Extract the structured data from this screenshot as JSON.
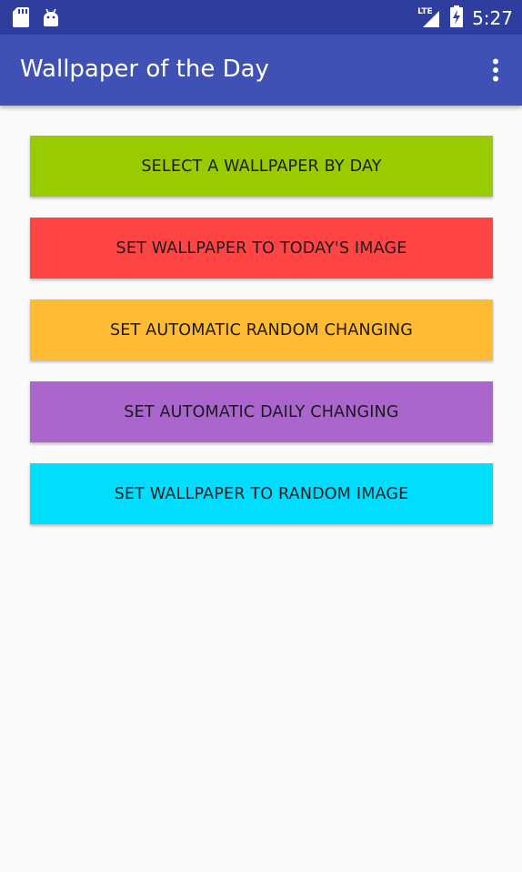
{
  "status_bar": {
    "time": "5:27",
    "network_label": "LTE",
    "icons": [
      "sd-card-icon",
      "android-icon",
      "signal-icon",
      "battery-charging-icon"
    ]
  },
  "app_bar": {
    "title": "Wallpaper of the Day",
    "menu_icon": "more-vert-icon"
  },
  "buttons": [
    {
      "label": "SELECT A WALLPAPER BY DAY",
      "color": "#99cc00"
    },
    {
      "label": "SET WALLPAPER TO TODAY'S IMAGE",
      "color": "#ff4444"
    },
    {
      "label": "SET AUTOMATIC RANDOM CHANGING",
      "color": "#ffbb33"
    },
    {
      "label": "SET AUTOMATIC DAILY CHANGING",
      "color": "#aa66cc"
    },
    {
      "label": "SET WALLPAPER TO RANDOM IMAGE",
      "color": "#00ddff"
    }
  ],
  "colors": {
    "status_bar": "#2f3d9e",
    "app_bar": "#3f51b5",
    "background": "#fafafa"
  }
}
